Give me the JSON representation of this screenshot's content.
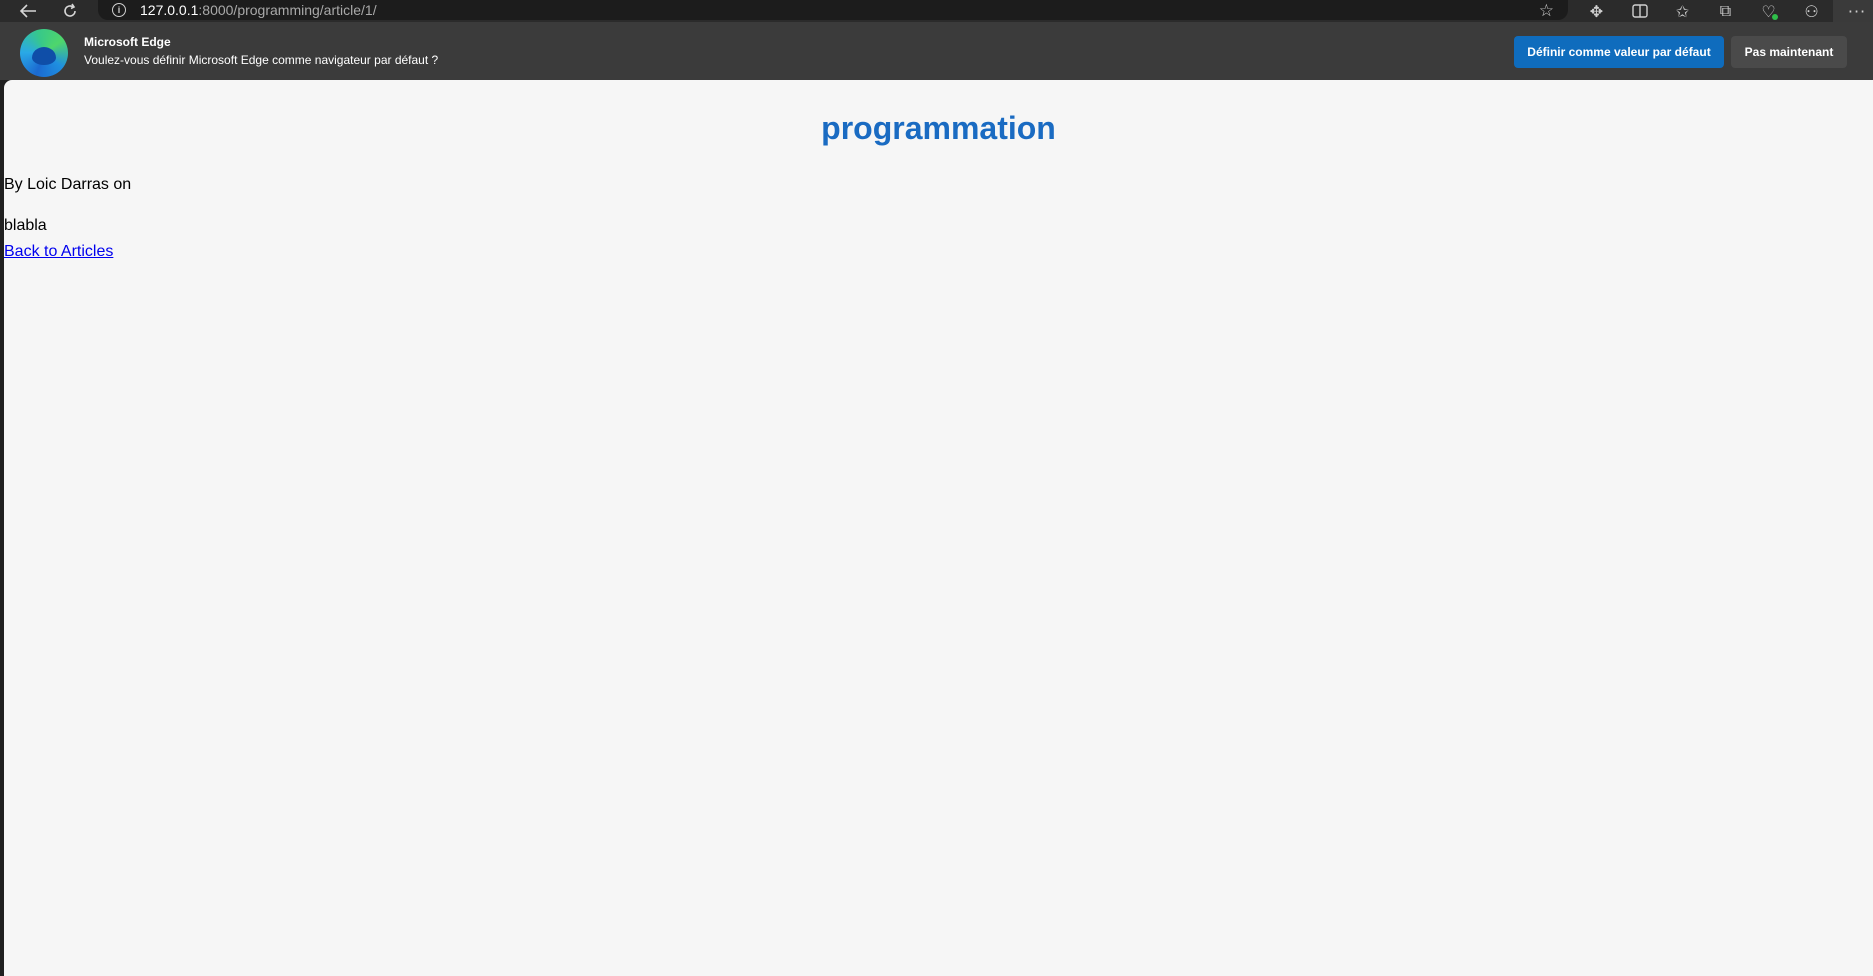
{
  "browser": {
    "url_host": "127.0.0.1",
    "url_path": ":8000/programming/article/1/",
    "icons": {
      "back": "back-arrow-icon",
      "refresh": "refresh-icon",
      "info": "info-icon",
      "favorite": "star-icon",
      "toolbar": [
        "extensions-icon",
        "split-screen-icon",
        "favorites-icon",
        "collections-icon",
        "browser-essentials-icon",
        "copilot-icon",
        "more-icon"
      ]
    }
  },
  "infobar": {
    "title": "Microsoft Edge",
    "message": "Voulez-vous définir Microsoft Edge comme navigateur par défaut ?",
    "primary_label": "Définir comme valeur par défaut",
    "secondary_label": "Pas maintenant",
    "primary_color": "#0f6cbd"
  },
  "article": {
    "title": "programmation",
    "byline": "By Loic Darras on",
    "body": "blabla",
    "back_link": "Back to Articles",
    "title_color": "#1a6bc2"
  }
}
